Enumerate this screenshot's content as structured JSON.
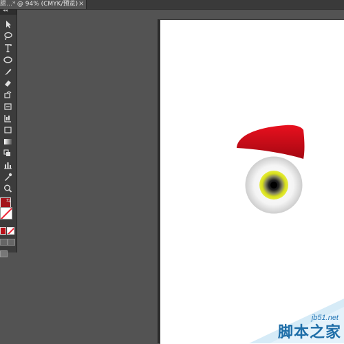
{
  "document_tab": {
    "title_prefix": "腮…*",
    "title": "@ 94% (CMYK/预览)",
    "close_symbol": "×"
  },
  "toolbar": {
    "grip_icon": "double-arrow-icon",
    "tools": [
      "selection-tool-icon",
      "lasso-tool-icon",
      "type-tool-icon",
      "ellipse-tool-icon",
      "pencil-tool-icon",
      "eraser-tool-icon",
      "rotate-tool-icon",
      "width-tool-icon",
      "shape-builder-tool-icon",
      "perspective-grid-tool-icon",
      "gradient-tool-icon",
      "blend-tool-icon",
      "column-graph-tool-icon",
      "eyedropper-tool-icon",
      "zoom-tool-icon"
    ],
    "fill_color": "#a4141b",
    "stroke_color": "none"
  },
  "artwork": {
    "cap_color": "#d3111e",
    "eyeball_color": "#e6e6e6",
    "iris_color": "#d8e01a",
    "pupil_color": "#111111"
  },
  "watermark": {
    "url": "jb51.net",
    "site_name": "脚本之家"
  }
}
